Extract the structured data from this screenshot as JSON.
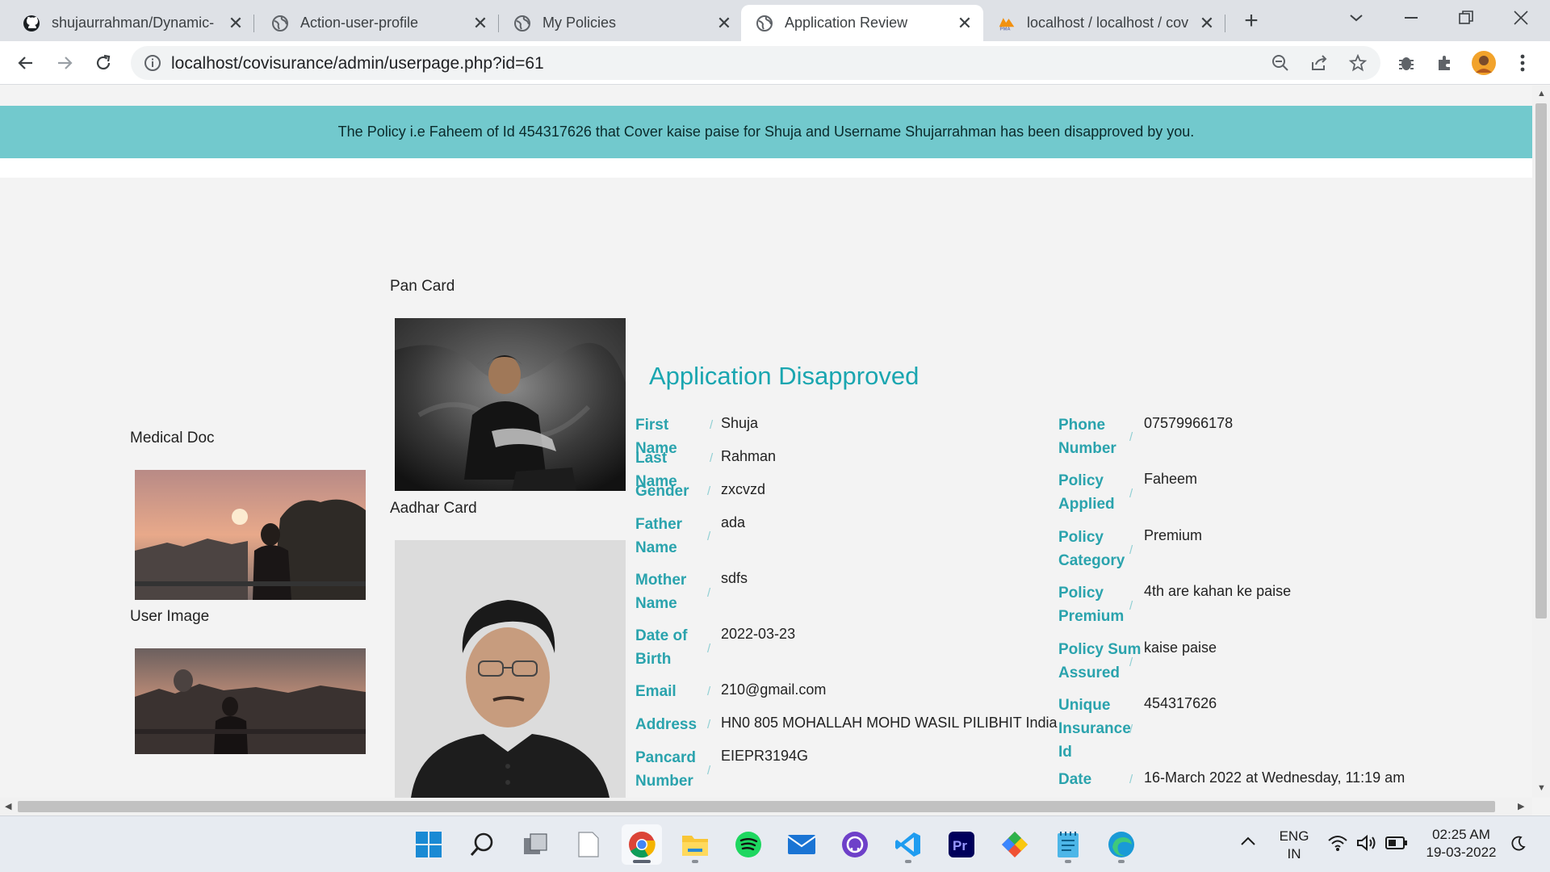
{
  "browser": {
    "tabs": [
      {
        "title": "shujaurrahman/Dynamic-",
        "icon": "github-icon",
        "active": false
      },
      {
        "title": "Action-user-profile",
        "icon": "globe-icon",
        "active": false
      },
      {
        "title": "My Policies",
        "icon": "globe-icon",
        "active": false
      },
      {
        "title": "Application Review",
        "icon": "globe-icon",
        "active": true
      },
      {
        "title": "localhost / localhost / cov",
        "icon": "phpmyadmin-icon",
        "active": false
      }
    ],
    "url": "localhost/covisurance/admin/userpage.php?id=61"
  },
  "page": {
    "alert_message": "The Policy i.e Faheem of Id 454317626 that Cover kaise paise for Shuja and Username Shujarrahman has been disapproved by you.",
    "documents": {
      "pan_card_label": "Pan Card",
      "aadhar_card_label": "Aadhar Card",
      "medical_doc_label": "Medical Doc",
      "user_image_label": "User Image"
    },
    "status_heading": "Application Disapproved",
    "separator": "/",
    "left_fields": [
      {
        "label": "First Name",
        "value": "Shuja"
      },
      {
        "label": "Last Name",
        "value": "Rahman"
      },
      {
        "label": "Gender",
        "value": "zxcvzd"
      },
      {
        "label": "Father Name",
        "value": "ada"
      },
      {
        "label": "Mother Name",
        "value": "sdfs"
      },
      {
        "label": "Date of Birth",
        "value": "2022-03-23"
      },
      {
        "label": "Email",
        "value": "210@gmail.com"
      },
      {
        "label": "Address",
        "value": "HN0 805 MOHALLAH MOHD WASIL PILIBHIT India"
      },
      {
        "label": "Pancard Number",
        "value": "EIEPR3194G"
      }
    ],
    "right_fields": [
      {
        "label": "Phone Number",
        "value": "07579966178"
      },
      {
        "label": "Policy Applied",
        "value": "Faheem"
      },
      {
        "label": "Policy Category",
        "value": "Premium"
      },
      {
        "label": "Policy Premium",
        "value": "4th are kahan ke paise"
      },
      {
        "label": "Policy Sum Assured",
        "value": "kaise paise"
      },
      {
        "label": "Unique Insurance Id",
        "value": "454317626"
      },
      {
        "label": "Date",
        "value": "16-March 2022 at Wednesday, 11:19 am"
      }
    ]
  },
  "taskbar": {
    "apps": [
      "windows-start-icon",
      "search-icon",
      "task-view-icon",
      "notepad-file-icon",
      "chrome-icon",
      "file-explorer-icon",
      "spotify-icon",
      "mail-icon",
      "github-desktop-icon",
      "vscode-icon",
      "premiere-pro-icon",
      "git-icon",
      "notepad-icon",
      "edge-icon"
    ],
    "language_line1": "ENG",
    "language_line2": "IN",
    "time": "02:25 AM",
    "date": "19-03-2022"
  },
  "colors": {
    "alert_bg": "#72c9cd",
    "accent": "#1aa6b0",
    "label": "#2aa3ad"
  }
}
